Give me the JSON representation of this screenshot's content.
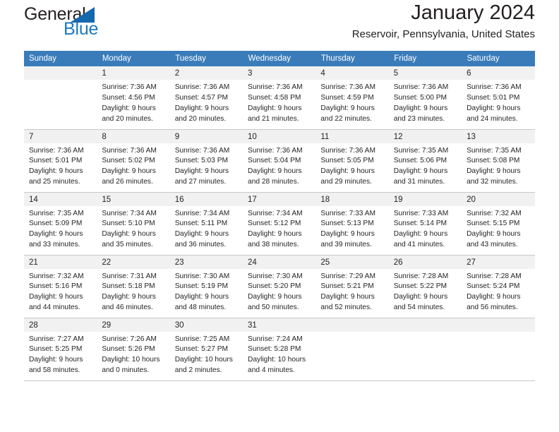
{
  "brand": {
    "name_top": "General",
    "name_bottom": "Blue",
    "accent_color": "#1b7ac4",
    "triangle_color": "#1668ad"
  },
  "header": {
    "title": "January 2024",
    "subtitle": "Reservoir, Pennsylvania, United States"
  },
  "calendar": {
    "header_color": "#3a7cba",
    "daynum_band_color": "#f1f1f1",
    "weekdays": [
      "Sunday",
      "Monday",
      "Tuesday",
      "Wednesday",
      "Thursday",
      "Friday",
      "Saturday"
    ],
    "weeks": [
      [
        {
          "day": "",
          "lines": []
        },
        {
          "day": "1",
          "lines": [
            "Sunrise: 7:36 AM",
            "Sunset: 4:56 PM",
            "Daylight: 9 hours",
            "and 20 minutes."
          ]
        },
        {
          "day": "2",
          "lines": [
            "Sunrise: 7:36 AM",
            "Sunset: 4:57 PM",
            "Daylight: 9 hours",
            "and 20 minutes."
          ]
        },
        {
          "day": "3",
          "lines": [
            "Sunrise: 7:36 AM",
            "Sunset: 4:58 PM",
            "Daylight: 9 hours",
            "and 21 minutes."
          ]
        },
        {
          "day": "4",
          "lines": [
            "Sunrise: 7:36 AM",
            "Sunset: 4:59 PM",
            "Daylight: 9 hours",
            "and 22 minutes."
          ]
        },
        {
          "day": "5",
          "lines": [
            "Sunrise: 7:36 AM",
            "Sunset: 5:00 PM",
            "Daylight: 9 hours",
            "and 23 minutes."
          ]
        },
        {
          "day": "6",
          "lines": [
            "Sunrise: 7:36 AM",
            "Sunset: 5:01 PM",
            "Daylight: 9 hours",
            "and 24 minutes."
          ]
        }
      ],
      [
        {
          "day": "7",
          "lines": [
            "Sunrise: 7:36 AM",
            "Sunset: 5:01 PM",
            "Daylight: 9 hours",
            "and 25 minutes."
          ]
        },
        {
          "day": "8",
          "lines": [
            "Sunrise: 7:36 AM",
            "Sunset: 5:02 PM",
            "Daylight: 9 hours",
            "and 26 minutes."
          ]
        },
        {
          "day": "9",
          "lines": [
            "Sunrise: 7:36 AM",
            "Sunset: 5:03 PM",
            "Daylight: 9 hours",
            "and 27 minutes."
          ]
        },
        {
          "day": "10",
          "lines": [
            "Sunrise: 7:36 AM",
            "Sunset: 5:04 PM",
            "Daylight: 9 hours",
            "and 28 minutes."
          ]
        },
        {
          "day": "11",
          "lines": [
            "Sunrise: 7:36 AM",
            "Sunset: 5:05 PM",
            "Daylight: 9 hours",
            "and 29 minutes."
          ]
        },
        {
          "day": "12",
          "lines": [
            "Sunrise: 7:35 AM",
            "Sunset: 5:06 PM",
            "Daylight: 9 hours",
            "and 31 minutes."
          ]
        },
        {
          "day": "13",
          "lines": [
            "Sunrise: 7:35 AM",
            "Sunset: 5:08 PM",
            "Daylight: 9 hours",
            "and 32 minutes."
          ]
        }
      ],
      [
        {
          "day": "14",
          "lines": [
            "Sunrise: 7:35 AM",
            "Sunset: 5:09 PM",
            "Daylight: 9 hours",
            "and 33 minutes."
          ]
        },
        {
          "day": "15",
          "lines": [
            "Sunrise: 7:34 AM",
            "Sunset: 5:10 PM",
            "Daylight: 9 hours",
            "and 35 minutes."
          ]
        },
        {
          "day": "16",
          "lines": [
            "Sunrise: 7:34 AM",
            "Sunset: 5:11 PM",
            "Daylight: 9 hours",
            "and 36 minutes."
          ]
        },
        {
          "day": "17",
          "lines": [
            "Sunrise: 7:34 AM",
            "Sunset: 5:12 PM",
            "Daylight: 9 hours",
            "and 38 minutes."
          ]
        },
        {
          "day": "18",
          "lines": [
            "Sunrise: 7:33 AM",
            "Sunset: 5:13 PM",
            "Daylight: 9 hours",
            "and 39 minutes."
          ]
        },
        {
          "day": "19",
          "lines": [
            "Sunrise: 7:33 AM",
            "Sunset: 5:14 PM",
            "Daylight: 9 hours",
            "and 41 minutes."
          ]
        },
        {
          "day": "20",
          "lines": [
            "Sunrise: 7:32 AM",
            "Sunset: 5:15 PM",
            "Daylight: 9 hours",
            "and 43 minutes."
          ]
        }
      ],
      [
        {
          "day": "21",
          "lines": [
            "Sunrise: 7:32 AM",
            "Sunset: 5:16 PM",
            "Daylight: 9 hours",
            "and 44 minutes."
          ]
        },
        {
          "day": "22",
          "lines": [
            "Sunrise: 7:31 AM",
            "Sunset: 5:18 PM",
            "Daylight: 9 hours",
            "and 46 minutes."
          ]
        },
        {
          "day": "23",
          "lines": [
            "Sunrise: 7:30 AM",
            "Sunset: 5:19 PM",
            "Daylight: 9 hours",
            "and 48 minutes."
          ]
        },
        {
          "day": "24",
          "lines": [
            "Sunrise: 7:30 AM",
            "Sunset: 5:20 PM",
            "Daylight: 9 hours",
            "and 50 minutes."
          ]
        },
        {
          "day": "25",
          "lines": [
            "Sunrise: 7:29 AM",
            "Sunset: 5:21 PM",
            "Daylight: 9 hours",
            "and 52 minutes."
          ]
        },
        {
          "day": "26",
          "lines": [
            "Sunrise: 7:28 AM",
            "Sunset: 5:22 PM",
            "Daylight: 9 hours",
            "and 54 minutes."
          ]
        },
        {
          "day": "27",
          "lines": [
            "Sunrise: 7:28 AM",
            "Sunset: 5:24 PM",
            "Daylight: 9 hours",
            "and 56 minutes."
          ]
        }
      ],
      [
        {
          "day": "28",
          "lines": [
            "Sunrise: 7:27 AM",
            "Sunset: 5:25 PM",
            "Daylight: 9 hours",
            "and 58 minutes."
          ]
        },
        {
          "day": "29",
          "lines": [
            "Sunrise: 7:26 AM",
            "Sunset: 5:26 PM",
            "Daylight: 10 hours",
            "and 0 minutes."
          ]
        },
        {
          "day": "30",
          "lines": [
            "Sunrise: 7:25 AM",
            "Sunset: 5:27 PM",
            "Daylight: 10 hours",
            "and 2 minutes."
          ]
        },
        {
          "day": "31",
          "lines": [
            "Sunrise: 7:24 AM",
            "Sunset: 5:28 PM",
            "Daylight: 10 hours",
            "and 4 minutes."
          ]
        },
        {
          "day": "",
          "lines": []
        },
        {
          "day": "",
          "lines": []
        },
        {
          "day": "",
          "lines": []
        }
      ]
    ]
  }
}
